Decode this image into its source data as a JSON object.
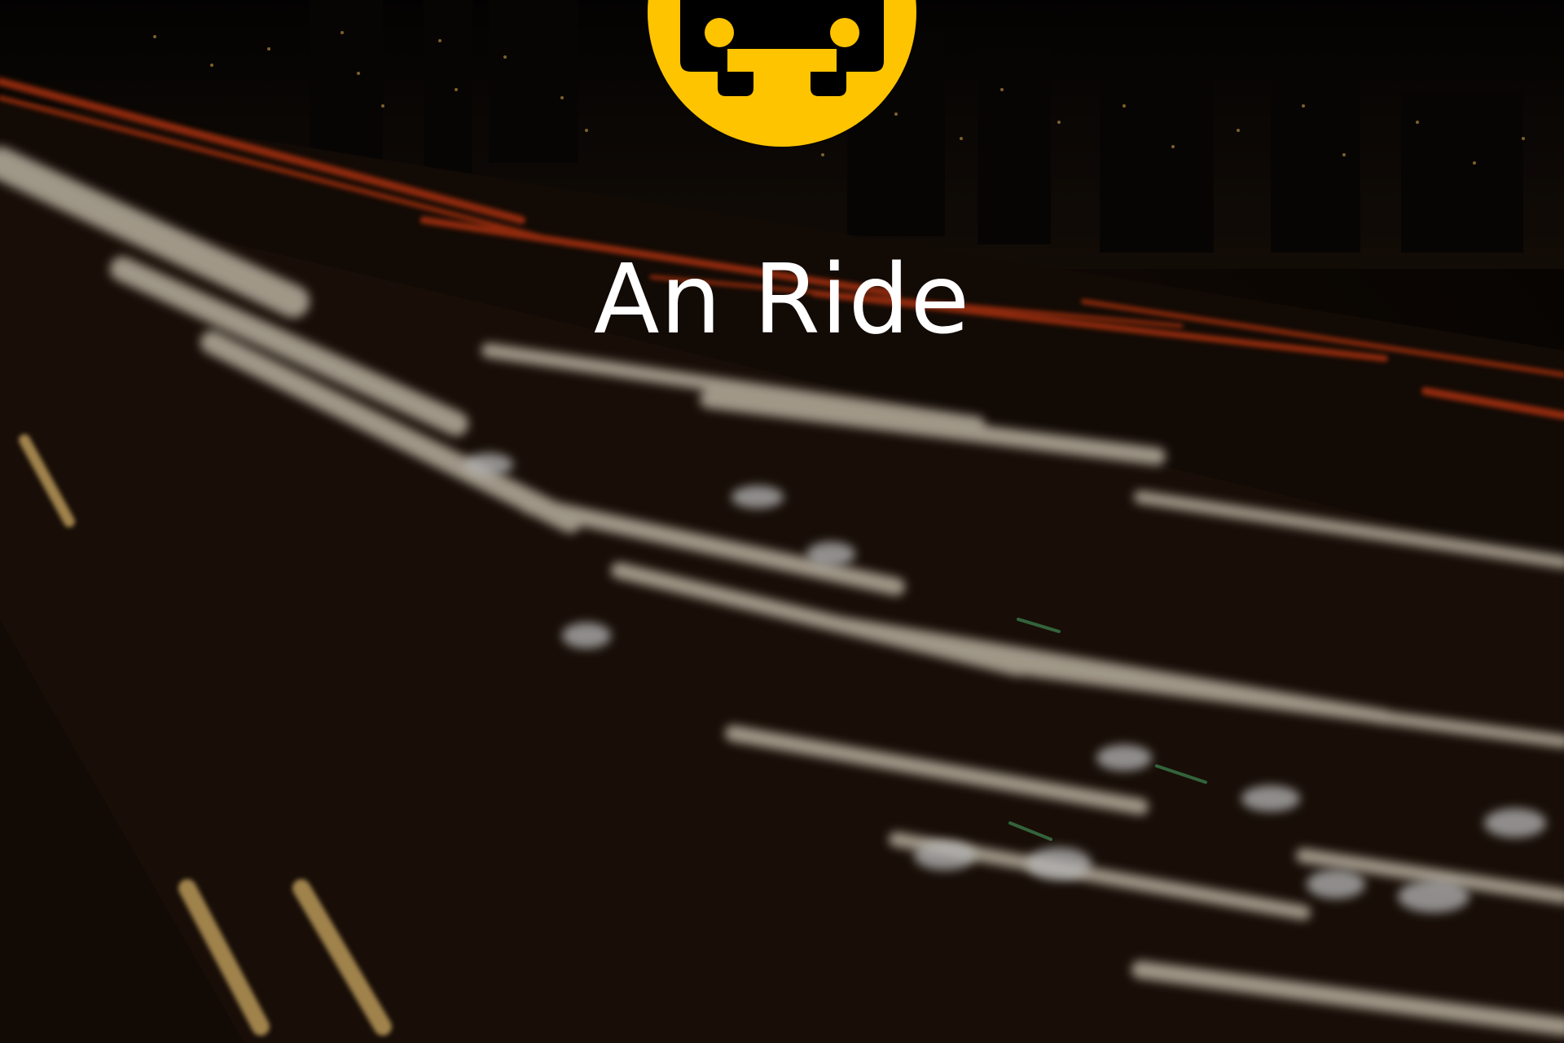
{
  "app": {
    "title": "An Ride"
  },
  "logo": {
    "icon": "car-front-icon",
    "background_color": "#FFC400",
    "icon_color": "#000000"
  },
  "background": {
    "description_icon": "night-highway-light-trails",
    "streak_colors": [
      "#ffffff",
      "#ffe6b0",
      "#ff5a1f",
      "#d23a10"
    ]
  }
}
